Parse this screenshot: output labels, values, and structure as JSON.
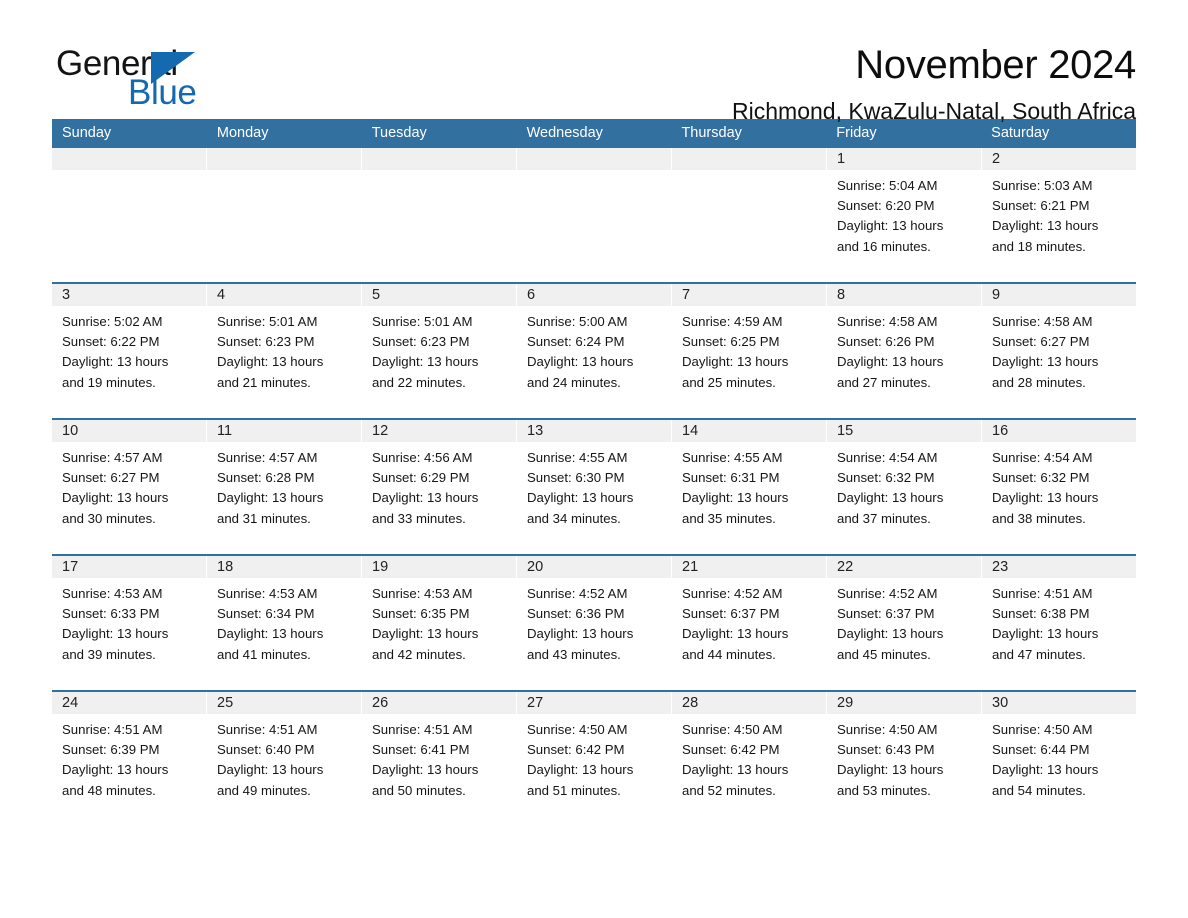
{
  "brand": {
    "name_part1": "General",
    "name_part2": "Blue",
    "triangle_icon": "triangle-icon",
    "accent_color": "#1569ae"
  },
  "header": {
    "title": "November 2024",
    "subtitle": "Richmond, KwaZulu-Natal, South Africa"
  },
  "theme": {
    "header_blue": "#32709f",
    "date_band_gray": "#f0f0f0",
    "cell_white": "#ffffff",
    "text_dark": "#161616"
  },
  "day_headers": [
    "Sunday",
    "Monday",
    "Tuesday",
    "Wednesday",
    "Thursday",
    "Friday",
    "Saturday"
  ],
  "labels": {
    "sunrise_prefix": "Sunrise:",
    "sunset_prefix": "Sunset:",
    "daylight_prefix": "Daylight:"
  },
  "weeks": [
    [
      {
        "date": "",
        "empty": true
      },
      {
        "date": "",
        "empty": true
      },
      {
        "date": "",
        "empty": true
      },
      {
        "date": "",
        "empty": true
      },
      {
        "date": "",
        "empty": true
      },
      {
        "date": "1",
        "sunrise": "Sunrise: 5:04 AM",
        "sunset": "Sunset: 6:20 PM",
        "daylight_l1": "Daylight: 13 hours",
        "daylight_l2": "and 16 minutes."
      },
      {
        "date": "2",
        "sunrise": "Sunrise: 5:03 AM",
        "sunset": "Sunset: 6:21 PM",
        "daylight_l1": "Daylight: 13 hours",
        "daylight_l2": "and 18 minutes."
      }
    ],
    [
      {
        "date": "3",
        "sunrise": "Sunrise: 5:02 AM",
        "sunset": "Sunset: 6:22 PM",
        "daylight_l1": "Daylight: 13 hours",
        "daylight_l2": "and 19 minutes."
      },
      {
        "date": "4",
        "sunrise": "Sunrise: 5:01 AM",
        "sunset": "Sunset: 6:23 PM",
        "daylight_l1": "Daylight: 13 hours",
        "daylight_l2": "and 21 minutes."
      },
      {
        "date": "5",
        "sunrise": "Sunrise: 5:01 AM",
        "sunset": "Sunset: 6:23 PM",
        "daylight_l1": "Daylight: 13 hours",
        "daylight_l2": "and 22 minutes."
      },
      {
        "date": "6",
        "sunrise": "Sunrise: 5:00 AM",
        "sunset": "Sunset: 6:24 PM",
        "daylight_l1": "Daylight: 13 hours",
        "daylight_l2": "and 24 minutes."
      },
      {
        "date": "7",
        "sunrise": "Sunrise: 4:59 AM",
        "sunset": "Sunset: 6:25 PM",
        "daylight_l1": "Daylight: 13 hours",
        "daylight_l2": "and 25 minutes."
      },
      {
        "date": "8",
        "sunrise": "Sunrise: 4:58 AM",
        "sunset": "Sunset: 6:26 PM",
        "daylight_l1": "Daylight: 13 hours",
        "daylight_l2": "and 27 minutes."
      },
      {
        "date": "9",
        "sunrise": "Sunrise: 4:58 AM",
        "sunset": "Sunset: 6:27 PM",
        "daylight_l1": "Daylight: 13 hours",
        "daylight_l2": "and 28 minutes."
      }
    ],
    [
      {
        "date": "10",
        "sunrise": "Sunrise: 4:57 AM",
        "sunset": "Sunset: 6:27 PM",
        "daylight_l1": "Daylight: 13 hours",
        "daylight_l2": "and 30 minutes."
      },
      {
        "date": "11",
        "sunrise": "Sunrise: 4:57 AM",
        "sunset": "Sunset: 6:28 PM",
        "daylight_l1": "Daylight: 13 hours",
        "daylight_l2": "and 31 minutes."
      },
      {
        "date": "12",
        "sunrise": "Sunrise: 4:56 AM",
        "sunset": "Sunset: 6:29 PM",
        "daylight_l1": "Daylight: 13 hours",
        "daylight_l2": "and 33 minutes."
      },
      {
        "date": "13",
        "sunrise": "Sunrise: 4:55 AM",
        "sunset": "Sunset: 6:30 PM",
        "daylight_l1": "Daylight: 13 hours",
        "daylight_l2": "and 34 minutes."
      },
      {
        "date": "14",
        "sunrise": "Sunrise: 4:55 AM",
        "sunset": "Sunset: 6:31 PM",
        "daylight_l1": "Daylight: 13 hours",
        "daylight_l2": "and 35 minutes."
      },
      {
        "date": "15",
        "sunrise": "Sunrise: 4:54 AM",
        "sunset": "Sunset: 6:32 PM",
        "daylight_l1": "Daylight: 13 hours",
        "daylight_l2": "and 37 minutes."
      },
      {
        "date": "16",
        "sunrise": "Sunrise: 4:54 AM",
        "sunset": "Sunset: 6:32 PM",
        "daylight_l1": "Daylight: 13 hours",
        "daylight_l2": "and 38 minutes."
      }
    ],
    [
      {
        "date": "17",
        "sunrise": "Sunrise: 4:53 AM",
        "sunset": "Sunset: 6:33 PM",
        "daylight_l1": "Daylight: 13 hours",
        "daylight_l2": "and 39 minutes."
      },
      {
        "date": "18",
        "sunrise": "Sunrise: 4:53 AM",
        "sunset": "Sunset: 6:34 PM",
        "daylight_l1": "Daylight: 13 hours",
        "daylight_l2": "and 41 minutes."
      },
      {
        "date": "19",
        "sunrise": "Sunrise: 4:53 AM",
        "sunset": "Sunset: 6:35 PM",
        "daylight_l1": "Daylight: 13 hours",
        "daylight_l2": "and 42 minutes."
      },
      {
        "date": "20",
        "sunrise": "Sunrise: 4:52 AM",
        "sunset": "Sunset: 6:36 PM",
        "daylight_l1": "Daylight: 13 hours",
        "daylight_l2": "and 43 minutes."
      },
      {
        "date": "21",
        "sunrise": "Sunrise: 4:52 AM",
        "sunset": "Sunset: 6:37 PM",
        "daylight_l1": "Daylight: 13 hours",
        "daylight_l2": "and 44 minutes."
      },
      {
        "date": "22",
        "sunrise": "Sunrise: 4:52 AM",
        "sunset": "Sunset: 6:37 PM",
        "daylight_l1": "Daylight: 13 hours",
        "daylight_l2": "and 45 minutes."
      },
      {
        "date": "23",
        "sunrise": "Sunrise: 4:51 AM",
        "sunset": "Sunset: 6:38 PM",
        "daylight_l1": "Daylight: 13 hours",
        "daylight_l2": "and 47 minutes."
      }
    ],
    [
      {
        "date": "24",
        "sunrise": "Sunrise: 4:51 AM",
        "sunset": "Sunset: 6:39 PM",
        "daylight_l1": "Daylight: 13 hours",
        "daylight_l2": "and 48 minutes."
      },
      {
        "date": "25",
        "sunrise": "Sunrise: 4:51 AM",
        "sunset": "Sunset: 6:40 PM",
        "daylight_l1": "Daylight: 13 hours",
        "daylight_l2": "and 49 minutes."
      },
      {
        "date": "26",
        "sunrise": "Sunrise: 4:51 AM",
        "sunset": "Sunset: 6:41 PM",
        "daylight_l1": "Daylight: 13 hours",
        "daylight_l2": "and 50 minutes."
      },
      {
        "date": "27",
        "sunrise": "Sunrise: 4:50 AM",
        "sunset": "Sunset: 6:42 PM",
        "daylight_l1": "Daylight: 13 hours",
        "daylight_l2": "and 51 minutes."
      },
      {
        "date": "28",
        "sunrise": "Sunrise: 4:50 AM",
        "sunset": "Sunset: 6:42 PM",
        "daylight_l1": "Daylight: 13 hours",
        "daylight_l2": "and 52 minutes."
      },
      {
        "date": "29",
        "sunrise": "Sunrise: 4:50 AM",
        "sunset": "Sunset: 6:43 PM",
        "daylight_l1": "Daylight: 13 hours",
        "daylight_l2": "and 53 minutes."
      },
      {
        "date": "30",
        "sunrise": "Sunrise: 4:50 AM",
        "sunset": "Sunset: 6:44 PM",
        "daylight_l1": "Daylight: 13 hours",
        "daylight_l2": "and 54 minutes."
      }
    ]
  ]
}
